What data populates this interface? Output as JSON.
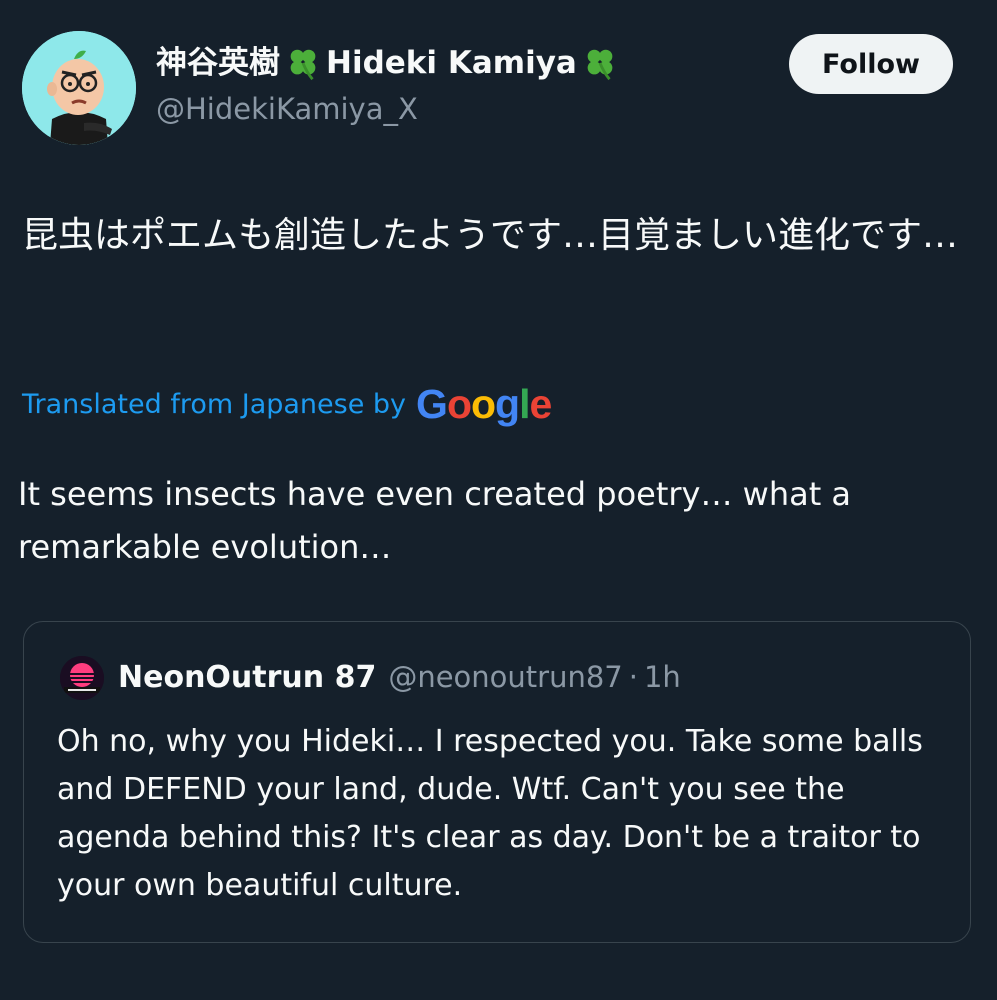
{
  "author": {
    "display_name_jp": "神谷英樹",
    "display_name_en": "Hideki Kamiya",
    "handle": "@HidekiKamiya_X",
    "avatar_icon": "cartoon-avatar-icon",
    "name_emoji_icon": "four-leaf-clover-icon"
  },
  "follow_button": {
    "label": "Follow"
  },
  "tweet": {
    "original_text": "昆虫はポエムも創造したようです…目覚ましい進化です…",
    "translation_label": "Translated from Japanese by",
    "translation_provider": "Google",
    "translated_text": "It seems insects have even created poetry… what a remarkable evolution…"
  },
  "quoted_tweet": {
    "display_name": "NeonOutrun 87",
    "handle": "@neonoutrun87",
    "separator": "·",
    "time": "1h",
    "avatar_icon": "neon-sunset-avatar-icon",
    "text": "Oh no, why you Hideki… I respected you. Take some balls and DEFEND your land, dude. Wtf. Can't you see the agenda behind this? It's clear as day. Don't be a traitor to your own beautiful culture."
  },
  "colors": {
    "background": "#15202b",
    "text_primary": "#f7f9f9",
    "text_secondary": "#8b98a5",
    "link_blue": "#1d9bf0",
    "card_border": "#38444d",
    "follow_bg": "#eff3f4"
  }
}
